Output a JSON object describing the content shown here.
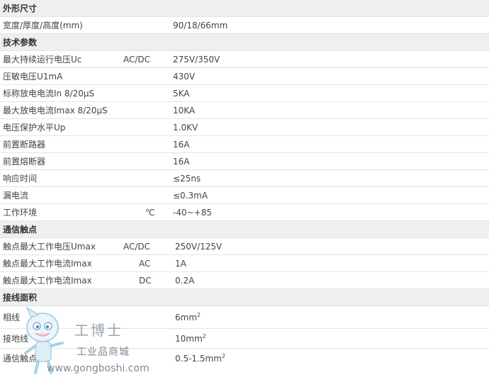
{
  "sections": [
    {
      "title": "外形尺寸",
      "rows": [
        {
          "label": "宽度/厚度/高度(mm)",
          "mid": "",
          "value": "90/18/66mm"
        }
      ]
    },
    {
      "title": "技术参数",
      "rows": [
        {
          "label": "最大持续运行电压Uc",
          "mid": "AC/DC",
          "value": "275V/350V"
        },
        {
          "label": "压敏电压U1mA",
          "mid": "",
          "value": "430V"
        },
        {
          "label": "标称放电电流In 8/20μS",
          "mid": "",
          "value": "5KA"
        },
        {
          "label": "最大放电电流Imax 8/20μS",
          "mid": "",
          "value": "10KA"
        },
        {
          "label": "电压保护水平Up",
          "mid": "",
          "value": "1.0KV"
        },
        {
          "label": "前置断路器",
          "mid": "",
          "value": "16A"
        },
        {
          "label": "前置熔断器",
          "mid": "",
          "value": "16A"
        },
        {
          "label": "响应时间",
          "mid": "",
          "value": "≤25ns"
        },
        {
          "label": "漏电流",
          "mid": "",
          "value": "≤0.3mA"
        },
        {
          "label": "工作环境",
          "mid": "℃",
          "value": "-40~+85"
        }
      ]
    },
    {
      "title": "通信触点",
      "rows": [
        {
          "label": "触点最大工作电压Umax",
          "mid": "AC/DC",
          "value": "250V/125V"
        },
        {
          "label": "触点最大工作电流Imax",
          "mid": "AC",
          "value": "1A"
        },
        {
          "label": "触点最大工作电流Imax",
          "mid": "DC",
          "value": "0.2A"
        }
      ]
    },
    {
      "title": "接线面积",
      "rows": [
        {
          "label": "相线",
          "mid": "",
          "value": "6mm",
          "sup": "2"
        },
        {
          "label": "接地线",
          "mid": "",
          "value": "10mm",
          "sup": "2"
        },
        {
          "label": "通信触点",
          "mid": "",
          "value": "0.5-1.5mm",
          "sup": "2"
        }
      ]
    }
  ],
  "watermark": {
    "brand": "工博士",
    "subtitle": "工业品商城",
    "url": "www.gongboshi.com"
  }
}
